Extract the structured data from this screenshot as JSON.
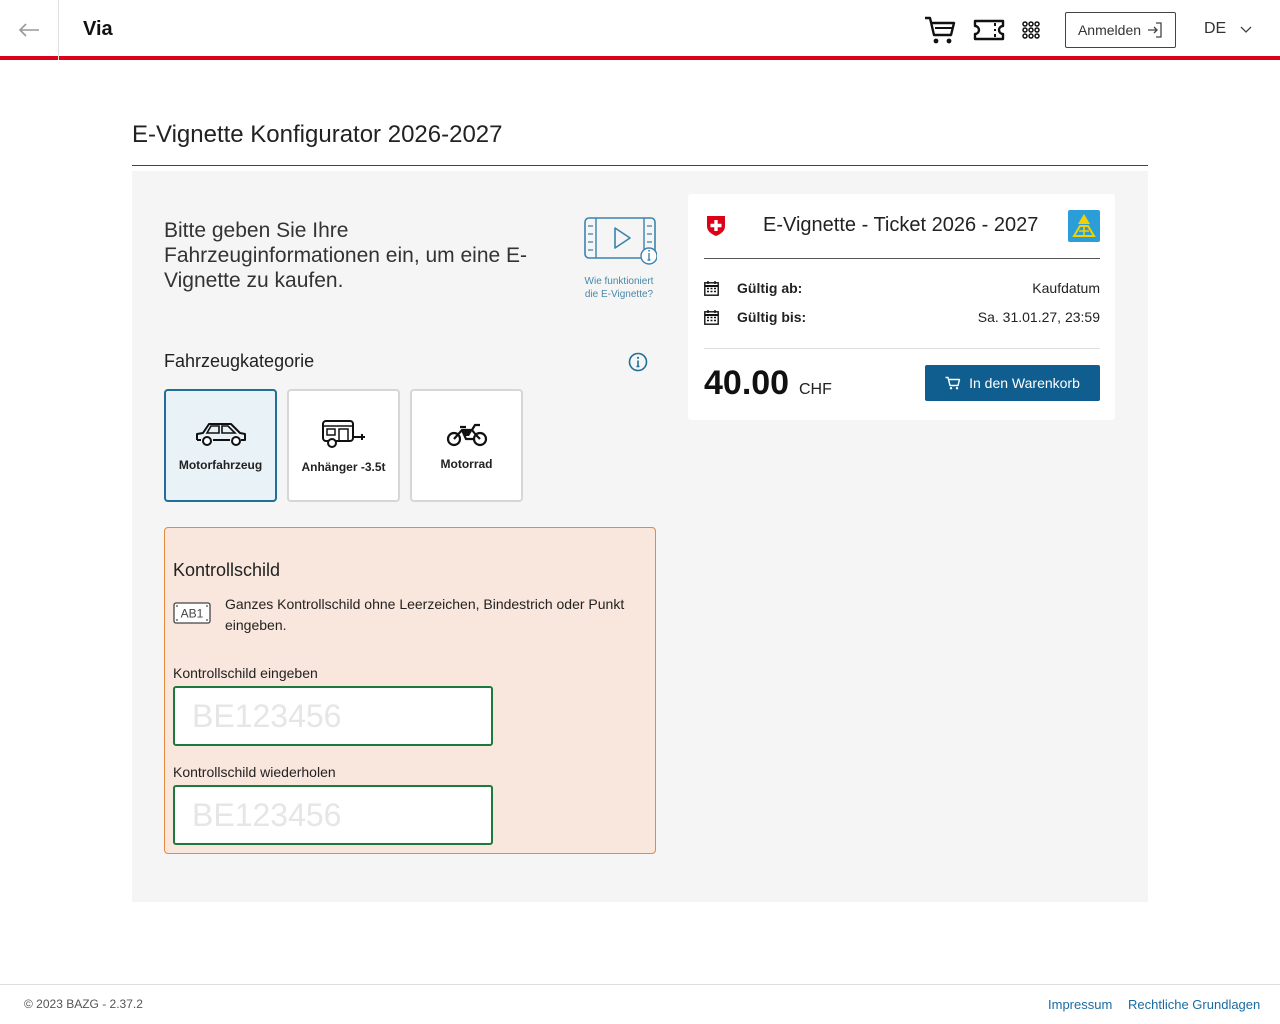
{
  "header": {
    "app_title": "Via",
    "login_label": "Anmelden",
    "language": "DE"
  },
  "page": {
    "title": "E-Vignette Konfigurator 2026-2027"
  },
  "intro": {
    "text": "Bitte geben Sie Ihre Fahrzeuginformationen ein, um eine E-Vignette zu kaufen.",
    "video_caption": "Wie funktioniert die E-Vignette?"
  },
  "category": {
    "label": "Fahrzeugkategorie",
    "selected": "Motorfahrzeug",
    "items": [
      {
        "label": "Motorfahrzeug",
        "icon": "car-icon"
      },
      {
        "label": "Anhänger -3.5t",
        "icon": "trailer-icon"
      },
      {
        "label": "Motorrad",
        "icon": "motorcycle-icon"
      }
    ]
  },
  "plate": {
    "title": "Kontrollschild",
    "hint_badge": "AB1",
    "hint": "Ganzes Kontrollschild ohne Leerzeichen, Bindestrich oder Punkt eingeben.",
    "enter_label": "Kontrollschild eingeben",
    "enter_placeholder": "BE123456",
    "enter_value": "",
    "repeat_label": "Kontrollschild wiederholen",
    "repeat_placeholder": "BE123456",
    "repeat_value": ""
  },
  "ticket": {
    "title": "E-Vignette - Ticket 2026 - 2027",
    "valid_from_label": "Gültig ab:",
    "valid_from_value": "Kaufdatum",
    "valid_to_label": "Gültig bis:",
    "valid_to_value": "Sa. 31.01.27, 23:59",
    "price": "40.00",
    "currency": "CHF",
    "cart_button": "In den Warenkorb"
  },
  "footer": {
    "copyright": "© 2023 BAZG - 2.37.2",
    "links": [
      "Impressum",
      "Rechtliche Grundlagen"
    ]
  },
  "colors": {
    "accent_red": "#dc0018",
    "primary_blue": "#0f5e8f",
    "selected_border": "#1f6f98",
    "plate_bg": "#f9e6dd",
    "plate_border": "#e58a3f",
    "input_border": "#1d7a3e"
  }
}
